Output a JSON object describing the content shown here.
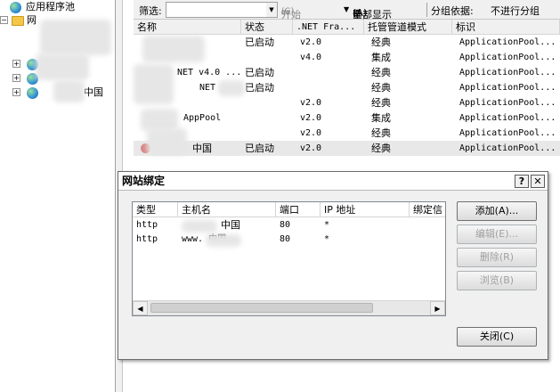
{
  "tree": {
    "root_label": "应用程序池",
    "item1_label": "网",
    "item4_label": "中国"
  },
  "filterbar": {
    "filter_label": "筛选:",
    "start_label": "开始",
    "show_all_label": "全部显示",
    "group_by_label": "分组依据:",
    "group_by_value": "不进行分组"
  },
  "list": {
    "columns": [
      "名称",
      "状态",
      ".NET Fra...",
      "托管管道模式",
      "标识"
    ],
    "rows": [
      {
        "name": "",
        "status": "已启动",
        "net": "v2.0",
        "mode": "经典",
        "identity": "ApplicationPool..."
      },
      {
        "name": "",
        "status": "",
        "net": "v4.0",
        "mode": "集成",
        "identity": "ApplicationPool..."
      },
      {
        "name": "NET v4.0 ...",
        "status": "已启动",
        "net": "",
        "mode": "经典",
        "identity": "ApplicationPool..."
      },
      {
        "name": "NET",
        "status": "已启动",
        "net": "",
        "mode": "经典",
        "identity": "ApplicationPool..."
      },
      {
        "name": "",
        "status": "",
        "net": "v2.0",
        "mode": "经典",
        "identity": "ApplicationPool..."
      },
      {
        "name": "AppPool",
        "status": "",
        "net": "v2.0",
        "mode": "集成",
        "identity": "ApplicationPool..."
      },
      {
        "name": "",
        "status": "",
        "net": "v2.0",
        "mode": "经典",
        "identity": "ApplicationPool..."
      },
      {
        "name": "中国",
        "status": "已启动",
        "net": "v2.0",
        "mode": "经典",
        "identity": "ApplicationPool..."
      }
    ]
  },
  "dialog": {
    "title": "网站绑定",
    "help_label": "?",
    "close_label": "✕",
    "columns": [
      "类型",
      "主机名",
      "端口",
      "IP 地址",
      "绑定信"
    ],
    "rows": [
      {
        "type": "http",
        "host": "中国",
        "port": "80",
        "ip": "*"
      },
      {
        "type": "http",
        "host": "www.        中国",
        "port": "80",
        "ip": "*"
      }
    ],
    "add_label": "添加(A)...",
    "edit_label": "编辑(E)...",
    "remove_label": "删除(R)",
    "browse_label": "浏览(B)",
    "close_button_label": "关闭(C)"
  }
}
